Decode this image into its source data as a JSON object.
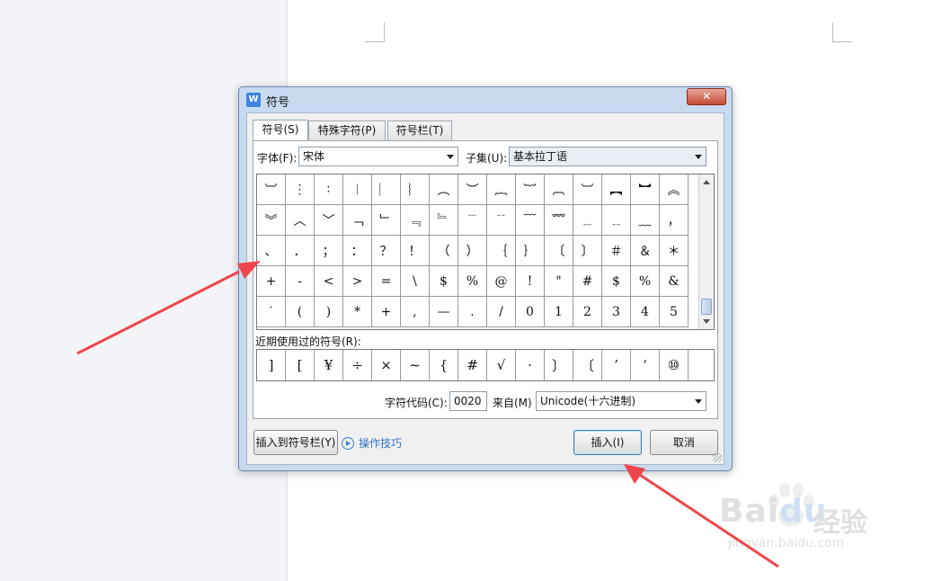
{
  "dialog": {
    "title": "符号",
    "app_icon_letter": "W",
    "close_glyph": "✕"
  },
  "tabs": [
    {
      "label": "符号(S)",
      "active": true
    },
    {
      "label": "特殊字符(P)",
      "active": false
    },
    {
      "label": "符号栏(T)",
      "active": false
    }
  ],
  "font": {
    "label": "字体(F):",
    "value": "宋体"
  },
  "subset": {
    "label": "子集(U):",
    "value": "基本拉丁语"
  },
  "symbol_grid": [
    [
      "︺",
      "⋮",
      "∶",
      "︱",
      "︳",
      "︴",
      "︵",
      "︶",
      "︷",
      "︸",
      "︹",
      "︺",
      "︻",
      "︼",
      "︽"
    ],
    [
      "︾",
      "︿",
      "﹀",
      "﹁",
      "﹂",
      "﹃",
      "﹄",
      "﹉",
      "﹊",
      "﹋",
      "﹌",
      "﹍",
      "﹎",
      "﹏",
      "，"
    ],
    [
      "、",
      "．",
      "；",
      "：",
      "？",
      "！",
      "（",
      "）",
      "｛",
      "｝",
      "〔",
      "〕",
      "＃",
      "＆",
      "＊"
    ],
    [
      "+",
      "-",
      "<",
      ">",
      "=",
      "\\",
      "$",
      "%",
      "@",
      "!",
      "\"",
      "#",
      "$",
      "%",
      "&"
    ],
    [
      "′",
      "(",
      ")",
      "*",
      "+",
      ",",
      "—",
      ".",
      "/",
      "0",
      "1",
      "2",
      "3",
      "4",
      "5"
    ]
  ],
  "recent": {
    "label": "近期使用过的符号(R):",
    "symbols": [
      "]",
      "[",
      "¥",
      "÷",
      "×",
      "~",
      "{",
      "#",
      "√",
      "·",
      "〕",
      "〔",
      "’",
      "‘",
      "⑩"
    ]
  },
  "char_code": {
    "label": "字符代码(C):",
    "value": "0020"
  },
  "from": {
    "label": "来自(M)",
    "value": "Unicode(十六进制)"
  },
  "buttons": {
    "insert_to_bar": "插入到符号栏(Y)",
    "tips": "操作技巧",
    "insert": "插入(I)",
    "cancel": "取消"
  },
  "watermark": {
    "brand": "Bai",
    "brand_du": "du",
    "cn": "经验",
    "url": "jingyan.baidu.com"
  },
  "colors": {
    "arrow": "#f0454a",
    "accent": "#3b7fd6"
  }
}
